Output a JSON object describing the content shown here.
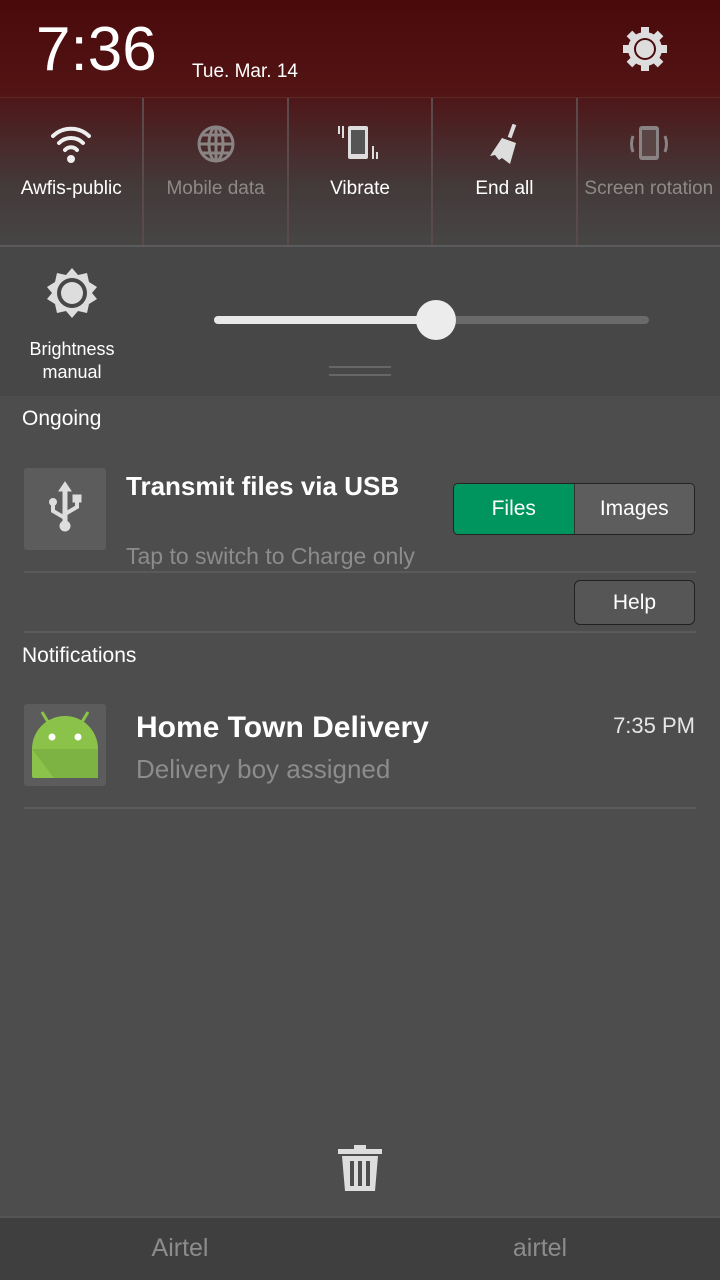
{
  "header": {
    "time": "7:36",
    "date": "Tue. Mar. 14"
  },
  "quick_tiles": [
    {
      "label": "Awfis-public",
      "icon": "wifi-icon",
      "active": true
    },
    {
      "label": "Mobile data",
      "icon": "globe-icon",
      "active": false
    },
    {
      "label": "Vibrate",
      "icon": "vibrate-icon",
      "active": true
    },
    {
      "label": "End all",
      "icon": "broom-icon",
      "active": true
    },
    {
      "label": "Screen rotation",
      "icon": "rotation-icon",
      "active": false
    }
  ],
  "brightness": {
    "label": "Brightness manual",
    "value_percent": 51
  },
  "ongoing": {
    "heading": "Ongoing",
    "title": "Transmit files via USB",
    "subtitle": "Tap to switch to Charge only",
    "options": [
      "Files",
      "Images"
    ],
    "selected": "Files",
    "help": "Help",
    "accent": "#00945f"
  },
  "notifications": {
    "heading": "Notifications",
    "items": [
      {
        "title": "Home Town Delivery",
        "text": "Delivery boy assigned",
        "time": "7:35 PM"
      }
    ]
  },
  "carriers": [
    "Airtel",
    "airtel"
  ]
}
